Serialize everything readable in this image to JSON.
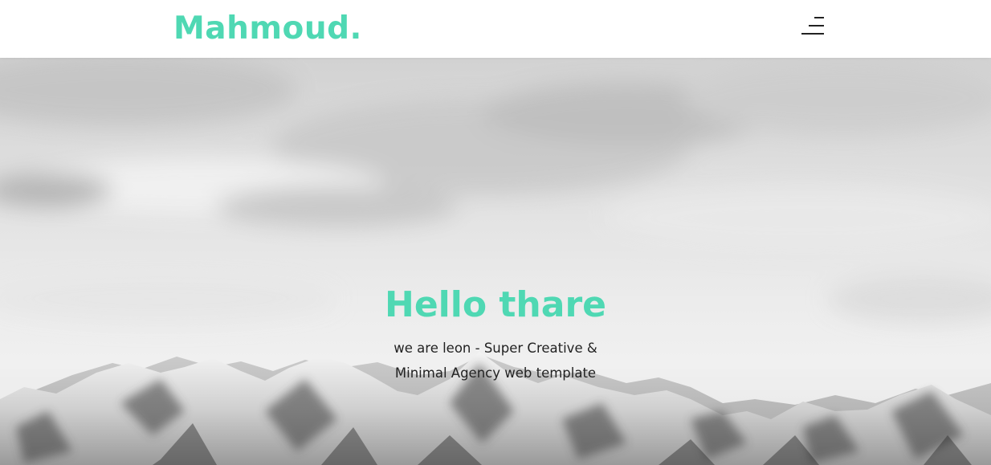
{
  "header": {
    "logo_text": "Mahmoud.",
    "menu_icon": "menu-hamburger-icon"
  },
  "hero": {
    "title": "Hello thare",
    "subtitle": "we are leon - Super Creative & Minimal Agency web template",
    "background": "grayscale snowy mountain range under cloudy sky"
  },
  "colors": {
    "accent": "#4fd8b3",
    "text": "#222222",
    "header_bg": "#ffffff"
  }
}
